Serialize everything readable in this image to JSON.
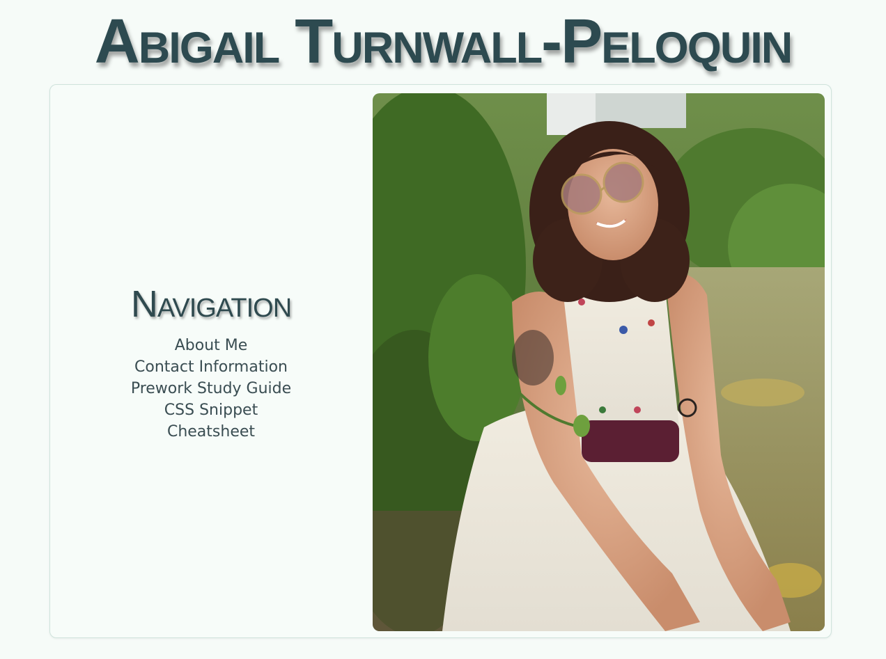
{
  "header": {
    "title": "Abigail Turnwall-Peloquin"
  },
  "navigation": {
    "heading": "Navigation",
    "links": [
      {
        "label": "About Me"
      },
      {
        "label": "Contact Information"
      },
      {
        "label": "Prework Study Guide"
      },
      {
        "label": "CSS Snippet"
      },
      {
        "label": "Cheatsheet"
      }
    ]
  },
  "photo": {
    "icon": "portrait-photo"
  },
  "colors": {
    "background": "#f6fbf8",
    "title": "#2d4a50",
    "text": "#3a4d52",
    "border": "#cfe3dc"
  }
}
